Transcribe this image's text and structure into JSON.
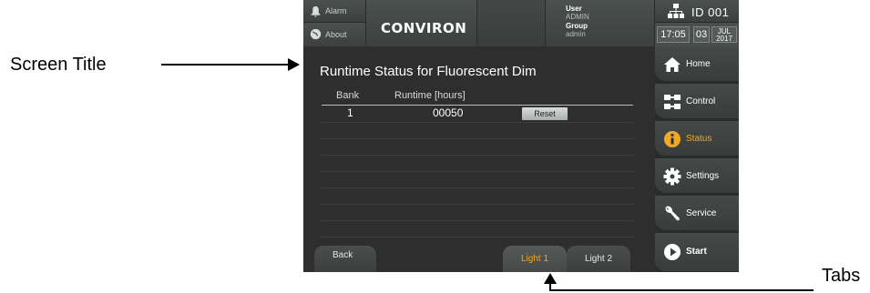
{
  "annotations": {
    "screen_title_label": "Screen Title",
    "tabs_label": "Tabs"
  },
  "topbar": {
    "alarm_label": "Alarm",
    "about_label": "About",
    "logo_text": "CONVIRON",
    "user_label": "User",
    "user_value": "ADMIN",
    "group_label": "Group",
    "group_value": "admin",
    "id_label": "ID 001",
    "time": "17:05",
    "date_day": "03",
    "date_month": "JUL",
    "date_year": "2017"
  },
  "main": {
    "title": "Runtime Status for Fluorescent Dim",
    "columns": [
      "Bank",
      "Runtime [hours]"
    ],
    "rows": [
      {
        "bank": "1",
        "runtime": "00050",
        "action": "Reset"
      }
    ]
  },
  "bottom": {
    "back_label": "Back",
    "tabs": [
      {
        "label": "Light 1",
        "active": true
      },
      {
        "label": "Light 2",
        "active": false
      }
    ]
  },
  "sidenav": {
    "items": [
      {
        "label": "Home",
        "icon": "home-icon"
      },
      {
        "label": "Control",
        "icon": "control-icon"
      },
      {
        "label": "Status",
        "icon": "info-icon",
        "active": true
      },
      {
        "label": "Settings",
        "icon": "gear-icon"
      },
      {
        "label": "Service",
        "icon": "wrench-icon"
      },
      {
        "label": "Start",
        "icon": "play-icon"
      }
    ]
  },
  "colors": {
    "accent": "#f0a825",
    "background": "#2e2e2e"
  }
}
